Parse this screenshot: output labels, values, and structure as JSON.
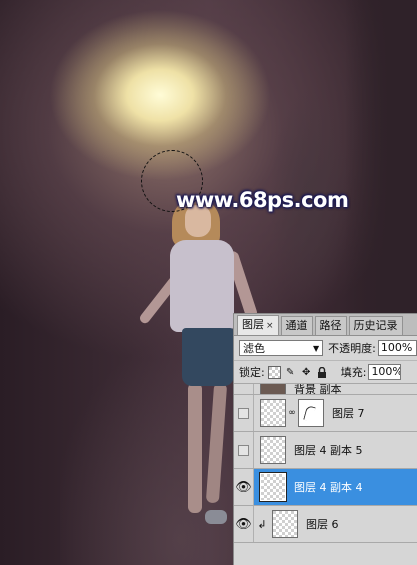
{
  "watermark": "www.68ps.com",
  "layers_panel": {
    "tabs": [
      {
        "label": "图层",
        "close": "×",
        "active": true
      },
      {
        "label": "通道",
        "active": false
      },
      {
        "label": "路径",
        "active": false
      },
      {
        "label": "历史记录",
        "active": false
      }
    ],
    "blend_mode": "滤色",
    "opacity_label": "不透明度:",
    "opacity_value": "100%",
    "lock_label": "锁定:",
    "fill_label": "填充:",
    "fill_value": "100%",
    "layers": [
      {
        "name": "背景 副本",
        "visible": false,
        "partial": true
      },
      {
        "name": "图层 7",
        "visible": false,
        "has_mask": true
      },
      {
        "name": "图层 4 副本 5",
        "visible": false
      },
      {
        "name": "图层 4 副本 4",
        "visible": true,
        "selected": true
      },
      {
        "name": "图层 6",
        "visible": true,
        "clipped": true
      }
    ]
  },
  "colors": {
    "selected_layer": "#3a8fe0",
    "panel_bg": "#d6d6d6",
    "watermark_glow": "#1b1a55"
  },
  "icons": {
    "eye": "eye-icon",
    "lock_transparent": "checkerboard-icon",
    "lock_paint": "brush-icon",
    "lock_move": "move-icon",
    "lock_all": "padlock-icon",
    "link": "chain-link-icon",
    "clip": "clipping-arrow-icon"
  }
}
